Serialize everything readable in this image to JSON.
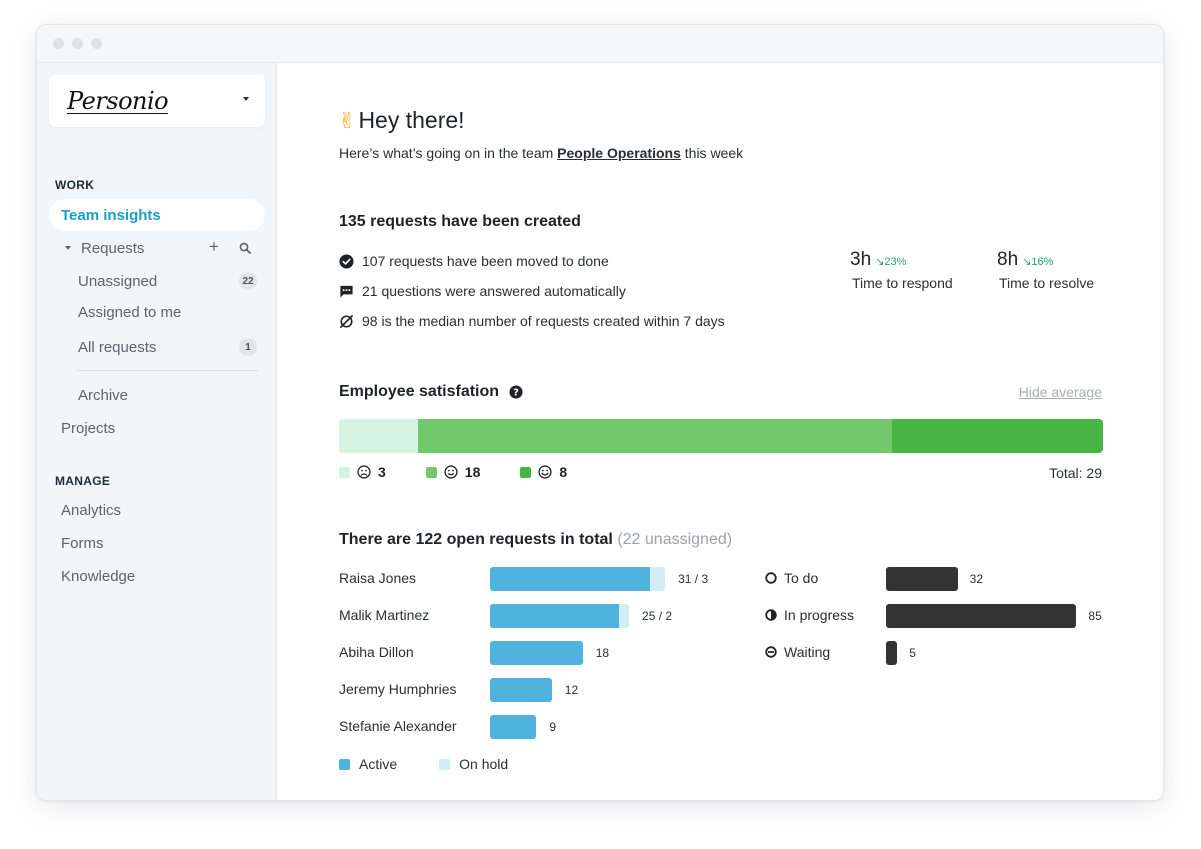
{
  "sidebar": {
    "logo": "Personio",
    "work_label": "WORK",
    "active_item": "Team insights",
    "requests_label": "Requests",
    "unassigned_label": "Unassigned",
    "unassigned_count": "22",
    "assigned_label": "Assigned to me",
    "all_label": "All requests",
    "all_count": "1",
    "archive_label": "Archive",
    "projects_label": "Projects",
    "manage_label": "MANAGE",
    "analytics_label": "Analytics",
    "forms_label": "Forms",
    "knowledge_label": "Knowledge"
  },
  "header": {
    "greeting_emoji": "✌",
    "greeting": "Hey there!",
    "subtitle_prefix": "Here’s what’s going on in the team",
    "team_name": "People Operations",
    "subtitle_suffix": "this week"
  },
  "summary": {
    "title": "135 requests have been created",
    "line1": "107 requests have been moved to done",
    "line2": "21 questions were answered automatically",
    "line3": "98 is the median number of requests created within 7 days",
    "respond_value": "3h",
    "respond_delta": "↘23%",
    "respond_label": "Time to respond",
    "resolve_value": "8h",
    "resolve_delta": "↘16%",
    "resolve_label": "Time to resolve"
  },
  "satisfaction": {
    "title": "Employee satisfation",
    "hide_label": "Hide average",
    "segments": [
      {
        "count": 3,
        "color": "#d4f3e1"
      },
      {
        "count": 18,
        "color": "#72c96c"
      },
      {
        "count": 8,
        "color": "#47b543"
      }
    ],
    "count1": "3",
    "count2": "18",
    "count3": "8",
    "total_label": "Total: 29"
  },
  "open_requests": {
    "title": "There are 122 open requests in total",
    "subtitle": "(22 unassigned)",
    "assignees": [
      {
        "name": "Raisa Jones",
        "active": 31,
        "on_hold": 3,
        "label": "31 / 3"
      },
      {
        "name": "Malik Martinez",
        "active": 25,
        "on_hold": 2,
        "label": "25 / 2"
      },
      {
        "name": "Abiha Dillon",
        "active": 18,
        "on_hold": 0,
        "label": "18"
      },
      {
        "name": "Jeremy Humphries",
        "active": 12,
        "on_hold": 0,
        "label": "12"
      },
      {
        "name": "Stefanie Alexander",
        "active": 9,
        "on_hold": 0,
        "label": "9"
      }
    ],
    "statuses": [
      {
        "name": "To do",
        "value": 32,
        "label": "32"
      },
      {
        "name": "In progress",
        "value": 85,
        "label": "85"
      },
      {
        "name": "Waiting",
        "value": 5,
        "label": "5"
      }
    ],
    "legend_active": "Active",
    "legend_hold": "On hold",
    "active_color": "#4fb3de",
    "hold_color": "#d2ecf8",
    "status_color": "#333333"
  }
}
